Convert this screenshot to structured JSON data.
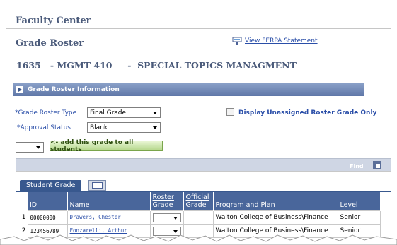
{
  "header": {
    "app_title": "Faculty Center",
    "page_title": "Grade Roster",
    "ferpa_link": "View FERPA Statement",
    "course_title": "1635   - MGMT 410     -  SPECIAL TOPICS MANAGMENT"
  },
  "section": {
    "title": "Grade Roster Information"
  },
  "form": {
    "roster_type_label": "*Grade Roster Type",
    "roster_type_value": "Final Grade",
    "approval_label": "*Approval Status",
    "approval_value": "Blank",
    "display_unassigned_label": "Display Unassigned Roster Grade Only",
    "add_grade_button": "<- add this grade to all students"
  },
  "grid": {
    "find_label": "Find",
    "separator": "|",
    "tab_label": "Student Grade",
    "columns": [
      "ID",
      "Name",
      "Roster Grade",
      "Official Grade",
      "Program and Plan",
      "Level"
    ],
    "rows": [
      {
        "num": "1",
        "id": "00000000",
        "name": "Drawers, Chester",
        "official": "",
        "program": "Walton College of Business\\Finance",
        "level": "Senior"
      },
      {
        "num": "2",
        "id": "123456789",
        "name": "Fonzarelli, Arthur",
        "official": "",
        "program": "Walton College of Business\\Finance",
        "level": "Senior"
      }
    ]
  },
  "colors": {
    "section_bar": "#5f77a8",
    "header_blue": "#49669b",
    "link_blue": "#2a4ea8",
    "button_green": "#b4d68a"
  }
}
